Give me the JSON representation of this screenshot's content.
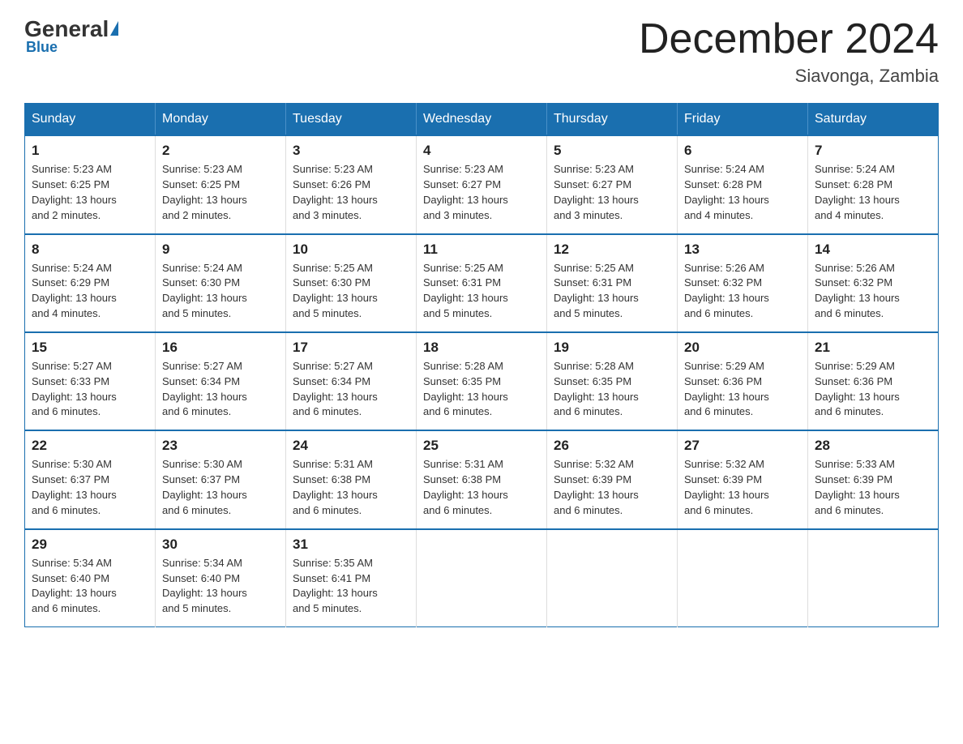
{
  "logo": {
    "general": "General",
    "triangle": "",
    "blue": "Blue"
  },
  "title": "December 2024",
  "location": "Siavonga, Zambia",
  "days_of_week": [
    "Sunday",
    "Monday",
    "Tuesday",
    "Wednesday",
    "Thursday",
    "Friday",
    "Saturday"
  ],
  "weeks": [
    [
      {
        "day": "1",
        "sunrise": "5:23 AM",
        "sunset": "6:25 PM",
        "daylight": "13 hours and 2 minutes."
      },
      {
        "day": "2",
        "sunrise": "5:23 AM",
        "sunset": "6:25 PM",
        "daylight": "13 hours and 2 minutes."
      },
      {
        "day": "3",
        "sunrise": "5:23 AM",
        "sunset": "6:26 PM",
        "daylight": "13 hours and 3 minutes."
      },
      {
        "day": "4",
        "sunrise": "5:23 AM",
        "sunset": "6:27 PM",
        "daylight": "13 hours and 3 minutes."
      },
      {
        "day": "5",
        "sunrise": "5:23 AM",
        "sunset": "6:27 PM",
        "daylight": "13 hours and 3 minutes."
      },
      {
        "day": "6",
        "sunrise": "5:24 AM",
        "sunset": "6:28 PM",
        "daylight": "13 hours and 4 minutes."
      },
      {
        "day": "7",
        "sunrise": "5:24 AM",
        "sunset": "6:28 PM",
        "daylight": "13 hours and 4 minutes."
      }
    ],
    [
      {
        "day": "8",
        "sunrise": "5:24 AM",
        "sunset": "6:29 PM",
        "daylight": "13 hours and 4 minutes."
      },
      {
        "day": "9",
        "sunrise": "5:24 AM",
        "sunset": "6:30 PM",
        "daylight": "13 hours and 5 minutes."
      },
      {
        "day": "10",
        "sunrise": "5:25 AM",
        "sunset": "6:30 PM",
        "daylight": "13 hours and 5 minutes."
      },
      {
        "day": "11",
        "sunrise": "5:25 AM",
        "sunset": "6:31 PM",
        "daylight": "13 hours and 5 minutes."
      },
      {
        "day": "12",
        "sunrise": "5:25 AM",
        "sunset": "6:31 PM",
        "daylight": "13 hours and 5 minutes."
      },
      {
        "day": "13",
        "sunrise": "5:26 AM",
        "sunset": "6:32 PM",
        "daylight": "13 hours and 6 minutes."
      },
      {
        "day": "14",
        "sunrise": "5:26 AM",
        "sunset": "6:32 PM",
        "daylight": "13 hours and 6 minutes."
      }
    ],
    [
      {
        "day": "15",
        "sunrise": "5:27 AM",
        "sunset": "6:33 PM",
        "daylight": "13 hours and 6 minutes."
      },
      {
        "day": "16",
        "sunrise": "5:27 AM",
        "sunset": "6:34 PM",
        "daylight": "13 hours and 6 minutes."
      },
      {
        "day": "17",
        "sunrise": "5:27 AM",
        "sunset": "6:34 PM",
        "daylight": "13 hours and 6 minutes."
      },
      {
        "day": "18",
        "sunrise": "5:28 AM",
        "sunset": "6:35 PM",
        "daylight": "13 hours and 6 minutes."
      },
      {
        "day": "19",
        "sunrise": "5:28 AM",
        "sunset": "6:35 PM",
        "daylight": "13 hours and 6 minutes."
      },
      {
        "day": "20",
        "sunrise": "5:29 AM",
        "sunset": "6:36 PM",
        "daylight": "13 hours and 6 minutes."
      },
      {
        "day": "21",
        "sunrise": "5:29 AM",
        "sunset": "6:36 PM",
        "daylight": "13 hours and 6 minutes."
      }
    ],
    [
      {
        "day": "22",
        "sunrise": "5:30 AM",
        "sunset": "6:37 PM",
        "daylight": "13 hours and 6 minutes."
      },
      {
        "day": "23",
        "sunrise": "5:30 AM",
        "sunset": "6:37 PM",
        "daylight": "13 hours and 6 minutes."
      },
      {
        "day": "24",
        "sunrise": "5:31 AM",
        "sunset": "6:38 PM",
        "daylight": "13 hours and 6 minutes."
      },
      {
        "day": "25",
        "sunrise": "5:31 AM",
        "sunset": "6:38 PM",
        "daylight": "13 hours and 6 minutes."
      },
      {
        "day": "26",
        "sunrise": "5:32 AM",
        "sunset": "6:39 PM",
        "daylight": "13 hours and 6 minutes."
      },
      {
        "day": "27",
        "sunrise": "5:32 AM",
        "sunset": "6:39 PM",
        "daylight": "13 hours and 6 minutes."
      },
      {
        "day": "28",
        "sunrise": "5:33 AM",
        "sunset": "6:39 PM",
        "daylight": "13 hours and 6 minutes."
      }
    ],
    [
      {
        "day": "29",
        "sunrise": "5:34 AM",
        "sunset": "6:40 PM",
        "daylight": "13 hours and 6 minutes."
      },
      {
        "day": "30",
        "sunrise": "5:34 AM",
        "sunset": "6:40 PM",
        "daylight": "13 hours and 5 minutes."
      },
      {
        "day": "31",
        "sunrise": "5:35 AM",
        "sunset": "6:41 PM",
        "daylight": "13 hours and 5 minutes."
      },
      null,
      null,
      null,
      null
    ]
  ],
  "labels": {
    "sunrise": "Sunrise:",
    "sunset": "Sunset:",
    "daylight": "Daylight:"
  }
}
